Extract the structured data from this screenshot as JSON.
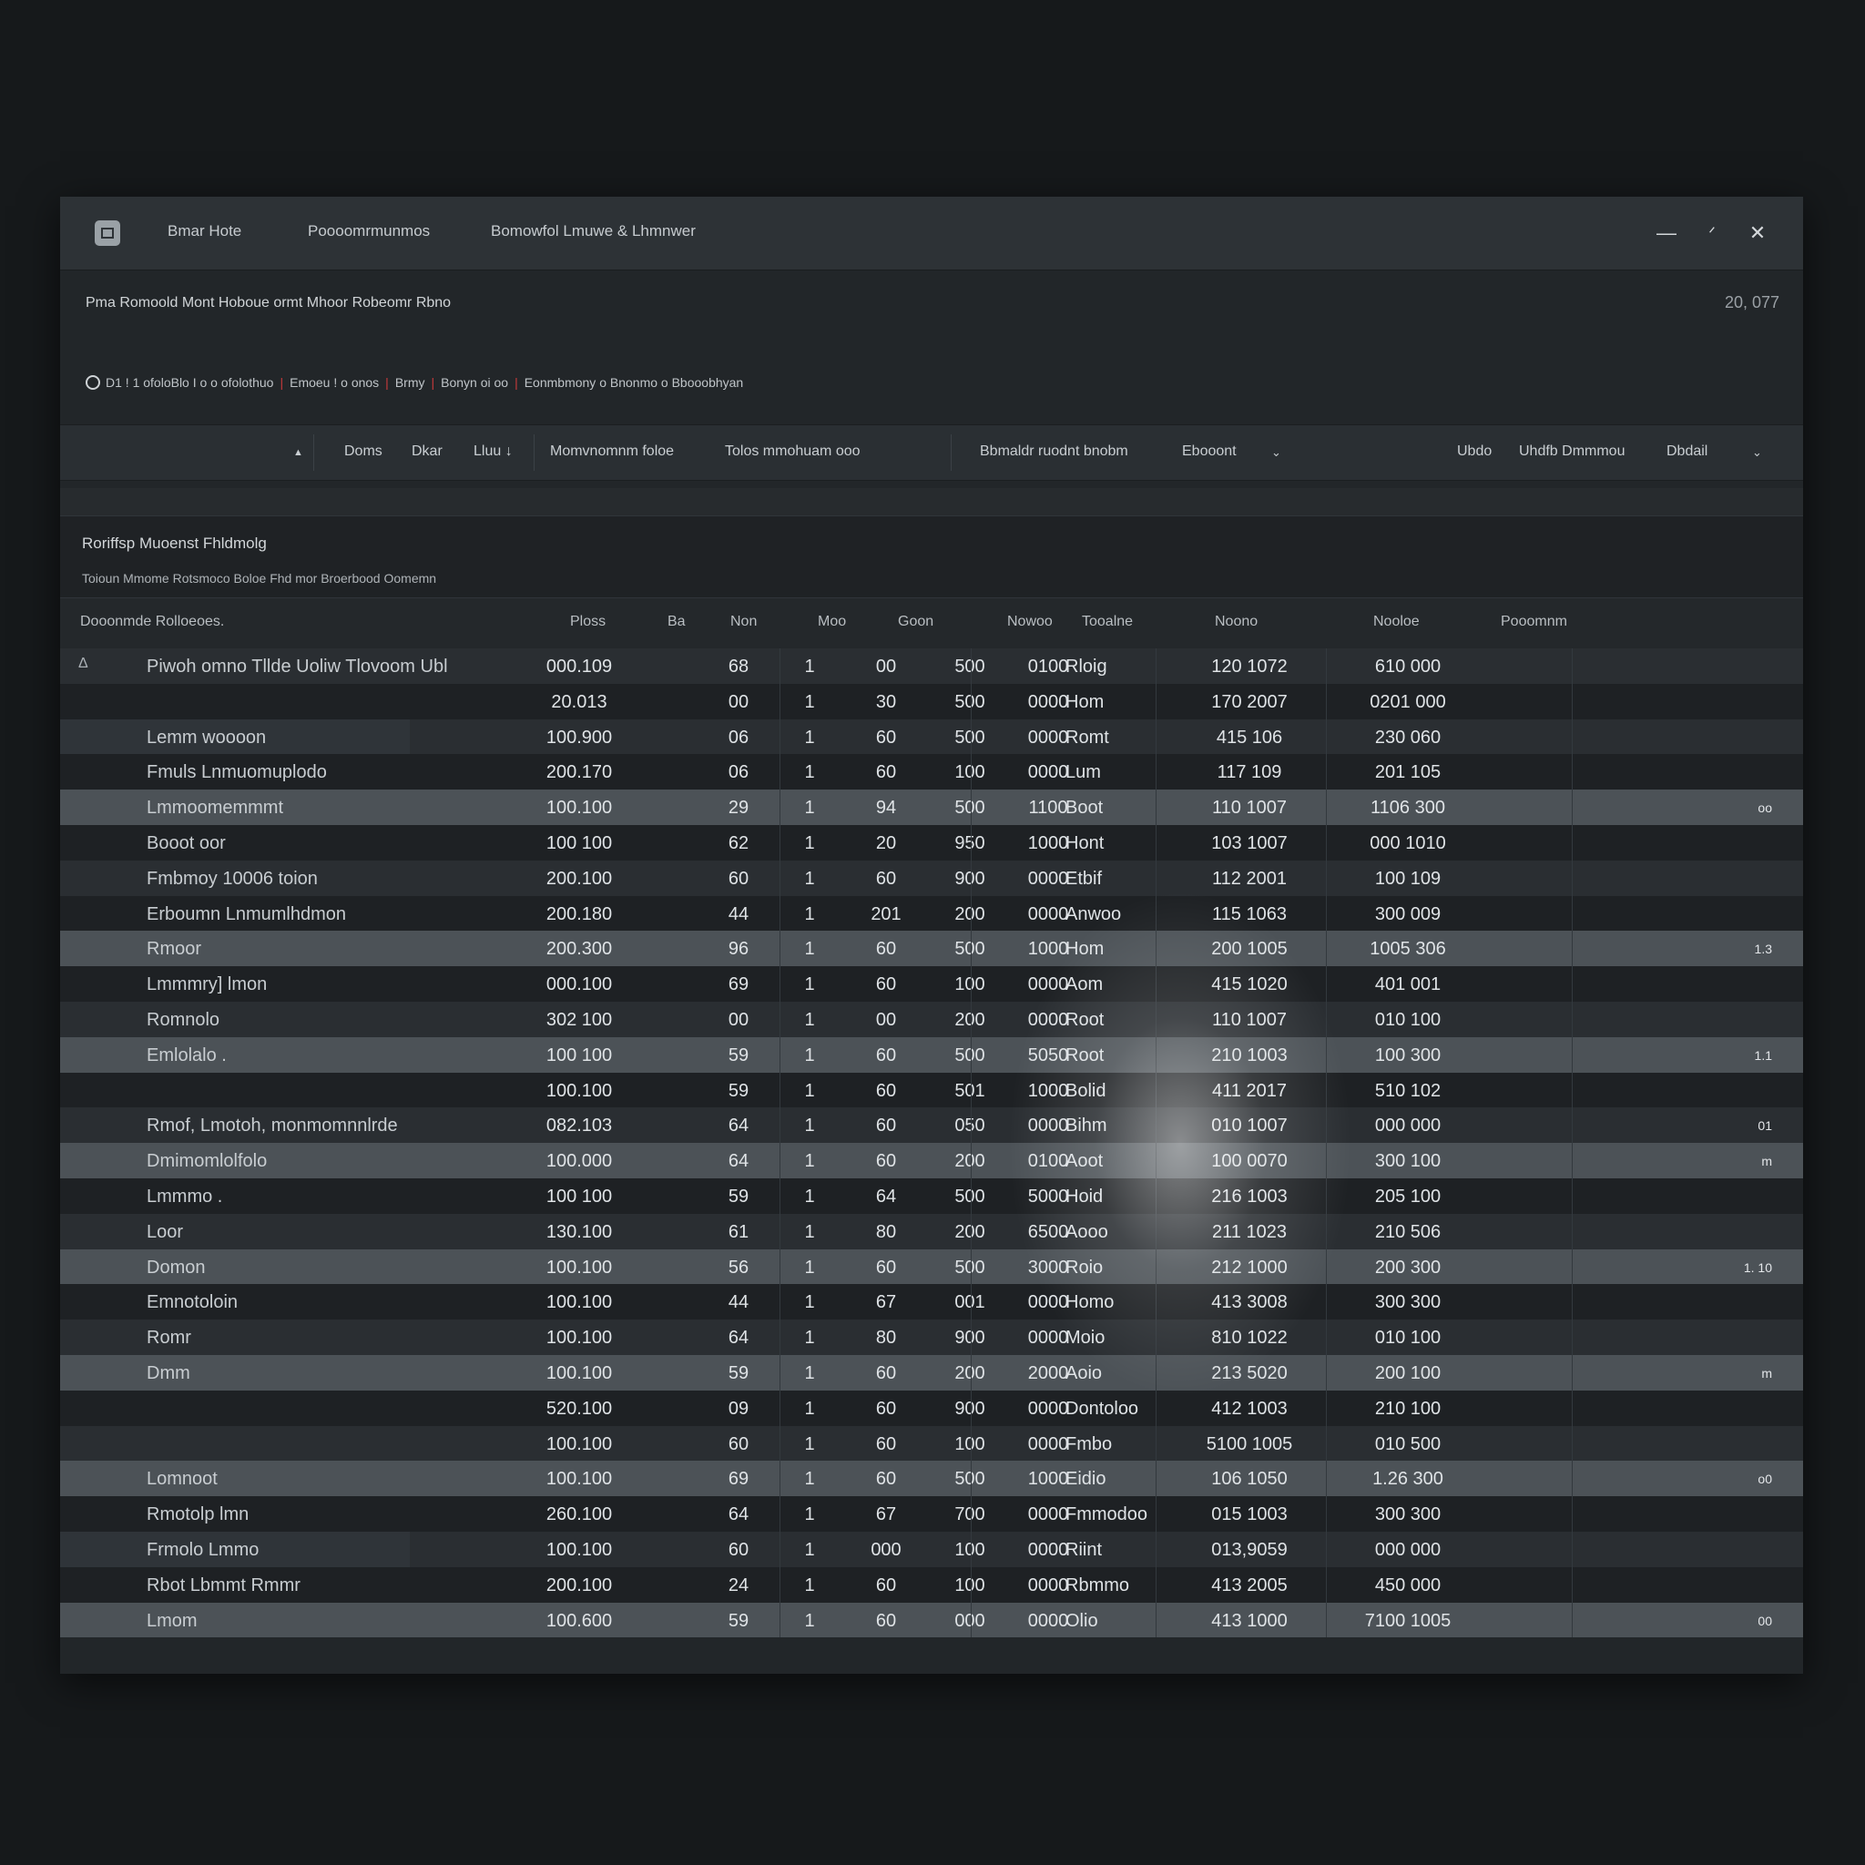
{
  "window": {
    "menu": [
      "Bmar Hote",
      "Poooomrmunmos",
      "Bomowfol Lmuwe & Lhmnwer"
    ],
    "controls": {
      "minimize": "—",
      "restore": "ᐟ",
      "close": "✕"
    }
  },
  "document": {
    "title": "Pma Romoold Mont Hoboue ormt Mhoor Robeomr Rbno",
    "stamp": "20, 077"
  },
  "breadcrumbs": [
    "D1 ! 1 ofoloBlo I o o ofolothuo",
    "Emoeu ! o onos",
    "Brmy",
    "Bonyn oi oo",
    "Eonmbmony o Bnonmo o Bbooobhyan"
  ],
  "toolbar": {
    "left_mark": "▲",
    "filters": [
      "Doms",
      "Dkar",
      "Lluu ↓"
    ],
    "groups": [
      "Momvnomnm foloe",
      "Tolos mmohuam ooo"
    ],
    "view_label": "Bbmaldr ruodnt bnobm",
    "view_value": "Ebooont",
    "right_items": [
      "Ubdo",
      "Uhdfb Dmmmou"
    ],
    "right_value": "Dbdail"
  },
  "section": {
    "title": "Roriffsp Muoenst Fhldmolg",
    "subtitle": "Toioun Mmome Rotsmoco Boloe Fhd mor Broerbood Oomemn"
  },
  "table": {
    "headers": [
      "Dooonmde Rolloeoes.",
      "Ploss",
      "Ba",
      "Non",
      "Moo",
      "Goon",
      "Nowoo",
      "Tooalne",
      "Noono",
      "Nooloe",
      "Pooomnm"
    ],
    "rows": [
      {
        "shade": "mid",
        "flag": "Δ",
        "name": "Piwoh omno Tllde    Uoliw Tlovoom Ubl",
        "a": "000.109",
        "b": "68",
        "c": "1",
        "d": "00",
        "e": "500",
        "f": "0100",
        "g": "Rloig",
        "h": "120 1072",
        "i": "610 000",
        "trail": ""
      },
      {
        "shade": "dark",
        "flag": "",
        "name": "",
        "a": "20.013",
        "b": "00",
        "c": "1",
        "d": "30",
        "e": "500",
        "f": "0000",
        "g": "Hom",
        "h": "170 2007",
        "i": "0201 000",
        "trail": ""
      },
      {
        "shade": "mid",
        "flag": "",
        "name": "Lemm woooon",
        "a": "100.900",
        "b": "06",
        "c": "1",
        "d": "60",
        "e": "500",
        "f": "0000",
        "g": "Romt",
        "h": "415 106",
        "i": "230 060",
        "trail": "",
        "bar": true
      },
      {
        "shade": "dark",
        "flag": "",
        "name": "Fmuls Lnmuomuplodo",
        "a": "200.170",
        "b": "06",
        "c": "1",
        "d": "60",
        "e": "100",
        "f": "0000",
        "g": "Lum",
        "h": "117 109",
        "i": "201 105",
        "trail": ""
      },
      {
        "shade": "light",
        "flag": "",
        "name": "Lmmoomemmmt",
        "a": "100.100",
        "b": "29",
        "c": "1",
        "d": "94",
        "e": "500",
        "f": "1100",
        "g": "Boot",
        "h": "110 1007",
        "i": "1106 300",
        "trail": "oo"
      },
      {
        "shade": "dark",
        "flag": "",
        "name": "Booot oor",
        "a": "100 100",
        "b": "62",
        "c": "1",
        "d": "20",
        "e": "950",
        "f": "1000",
        "g": "Hont",
        "h": "103 1007",
        "i": "000 1010",
        "trail": ""
      },
      {
        "shade": "mid",
        "flag": "",
        "name": "Fmbmoy 10006 toion",
        "a": "200.100",
        "b": "60",
        "c": "1",
        "d": "60",
        "e": "900",
        "f": "0000",
        "g": "Etbif",
        "h": "112 2001",
        "i": "100 109",
        "trail": ""
      },
      {
        "shade": "dark",
        "flag": "",
        "name": "Erboumn Lnmumlhdmon",
        "a": "200.180",
        "b": "44",
        "c": "1",
        "d": "201",
        "e": "200",
        "f": "0000",
        "g": "Anwoo",
        "h": "115 1063",
        "i": "300 009",
        "trail": ""
      },
      {
        "shade": "light",
        "flag": "",
        "name": "Rmoor",
        "a": "200.300",
        "b": "96",
        "c": "1",
        "d": "60",
        "e": "500",
        "f": "1000",
        "g": "Hom",
        "h": "200 1005",
        "i": "1005 306",
        "trail": "1.3"
      },
      {
        "shade": "dark",
        "flag": "",
        "name": "Lmmmry] lmon",
        "a": "000.100",
        "b": "69",
        "c": "1",
        "d": "60",
        "e": "100",
        "f": "0000",
        "g": "Aom",
        "h": "415 1020",
        "i": "401 001",
        "trail": ""
      },
      {
        "shade": "mid",
        "flag": "",
        "name": "Romnolo",
        "a": "302 100",
        "b": "00",
        "c": "1",
        "d": "00",
        "e": "200",
        "f": "0000",
        "g": "Root",
        "h": "110 1007",
        "i": "010 100",
        "trail": ""
      },
      {
        "shade": "light",
        "flag": "",
        "name": "Emlolalo .",
        "a": "100 100",
        "b": "59",
        "c": "1",
        "d": "60",
        "e": "500",
        "f": "5050",
        "g": "Root",
        "h": "210 1003",
        "i": "100 300",
        "trail": "1.1"
      },
      {
        "shade": "dark",
        "flag": "",
        "name": "",
        "a": "100.100",
        "b": "59",
        "c": "1",
        "d": "60",
        "e": "501",
        "f": "1000",
        "g": "Bolid",
        "h": "411 2017",
        "i": "510 102",
        "trail": ""
      },
      {
        "shade": "mid",
        "flag": "",
        "name": "Rmof, Lmotoh, monmomnnlrde",
        "a": "082.103",
        "b": "64",
        "c": "1",
        "d": "60",
        "e": "050",
        "f": "0000",
        "g": "Bihm",
        "h": "010 1007",
        "i": "000 000",
        "trail": "01"
      },
      {
        "shade": "light",
        "flag": "",
        "name": "Dmimomlolfolo",
        "a": "100.000",
        "b": "64",
        "c": "1",
        "d": "60",
        "e": "200",
        "f": "0100",
        "g": "Aoot",
        "h": "100 0070",
        "i": "300 100",
        "trail": "m"
      },
      {
        "shade": "dark",
        "flag": "",
        "name": "Lmmmo .",
        "a": "100 100",
        "b": "59",
        "c": "1",
        "d": "64",
        "e": "500",
        "f": "5000",
        "g": "Hoid",
        "h": "216 1003",
        "i": "205 100",
        "trail": ""
      },
      {
        "shade": "mid",
        "flag": "",
        "name": "Loor",
        "a": "130.100",
        "b": "61",
        "c": "1",
        "d": "80",
        "e": "200",
        "f": "6500",
        "g": "Aooo",
        "h": "211 1023",
        "i": "210 506",
        "trail": ""
      },
      {
        "shade": "light",
        "flag": "",
        "name": "Domon",
        "a": "100.100",
        "b": "56",
        "c": "1",
        "d": "60",
        "e": "500",
        "f": "3000",
        "g": "Roio",
        "h": "212 1000",
        "i": "200 300",
        "trail": "1. 10"
      },
      {
        "shade": "dark",
        "flag": "",
        "name": "Emnotoloin",
        "a": "100.100",
        "b": "44",
        "c": "1",
        "d": "67",
        "e": "001",
        "f": "0000",
        "g": "Homo",
        "h": "413 3008",
        "i": "300 300",
        "trail": ""
      },
      {
        "shade": "mid",
        "flag": "",
        "name": "Romr",
        "a": "100.100",
        "b": "64",
        "c": "1",
        "d": "80",
        "e": "900",
        "f": "0000",
        "g": "Moio",
        "h": "810 1022",
        "i": "010 100",
        "trail": ""
      },
      {
        "shade": "light",
        "flag": "",
        "name": "Dmm",
        "a": "100.100",
        "b": "59",
        "c": "1",
        "d": "60",
        "e": "200",
        "f": "2000",
        "g": "Aoio",
        "h": "213 5020",
        "i": "200 100",
        "trail": "m"
      },
      {
        "shade": "dark",
        "flag": "",
        "name": "",
        "a": "520.100",
        "b": "09",
        "c": "1",
        "d": "60",
        "e": "900",
        "f": "0000",
        "g": "Dontoloo",
        "h": "412 1003",
        "i": "210 100",
        "trail": ""
      },
      {
        "shade": "mid",
        "flag": "",
        "name": "",
        "a": "100.100",
        "b": "60",
        "c": "1",
        "d": "60",
        "e": "100",
        "f": "0000",
        "g": "Fmbo",
        "h": "5100 1005",
        "i": "010 500",
        "trail": ""
      },
      {
        "shade": "light",
        "flag": "",
        "name": "Lomnoot",
        "a": "100.100",
        "b": "69",
        "c": "1",
        "d": "60",
        "e": "500",
        "f": "1000",
        "g": "Eidio",
        "h": "106 1050",
        "i": "1.26 300",
        "trail": "o0"
      },
      {
        "shade": "dark",
        "flag": "",
        "name": "Rmotolp lmn",
        "a": "260.100",
        "b": "64",
        "c": "1",
        "d": "67",
        "e": "700",
        "f": "0000",
        "g": "Fmmodoo",
        "h": "015 1003",
        "i": "300 300",
        "trail": ""
      },
      {
        "shade": "mid",
        "flag": "",
        "name": "Frmolo Lmmo",
        "a": "100.100",
        "b": "60",
        "c": "1",
        "d": "000",
        "e": "100",
        "f": "0000",
        "g": "Riint",
        "h": "013,9059",
        "i": "000 000",
        "trail": "",
        "bar": true
      },
      {
        "shade": "dark",
        "flag": "",
        "name": "Rbot Lbmmt Rmmr",
        "a": "200.100",
        "b": "24",
        "c": "1",
        "d": "60",
        "e": "100",
        "f": "0000",
        "g": "Rbmmo",
        "h": "413 2005",
        "i": "450 000",
        "trail": ""
      },
      {
        "shade": "light",
        "flag": "",
        "name": "Lmom",
        "a": "100.600",
        "b": "59",
        "c": "1",
        "d": "60",
        "e": "000",
        "f": "0000",
        "g": "Olio",
        "h": "413 1000",
        "i": "7100 1005",
        "trail": "00"
      }
    ]
  },
  "colors": {
    "background": "#16191b",
    "window": "#222629",
    "titlebar": "#2d3236",
    "row_light": "#4c5257",
    "accent_red": "#c83a3a"
  }
}
